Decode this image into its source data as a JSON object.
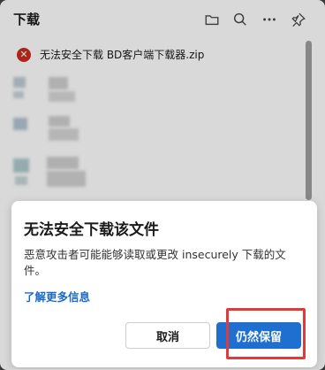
{
  "panel": {
    "title": "下载",
    "icons": [
      "folder-icon",
      "search-icon",
      "more-icon",
      "pin-icon"
    ]
  },
  "download_item": {
    "status_icon": "error-icon",
    "name": "无法安全下载 BD客户端下载器.zip"
  },
  "dialog": {
    "title": "无法安全下载该文件",
    "message": "恶意攻击者可能能够读取或更改 insecurely 下载的文件。",
    "link": "了解更多信息",
    "cancel_label": "取消",
    "keep_label": "仍然保留"
  },
  "colors": {
    "error": "#c42b1c",
    "primary_button": "#1f6fd0",
    "link": "#1b6ac9",
    "highlight_box": "#e03a3a"
  }
}
